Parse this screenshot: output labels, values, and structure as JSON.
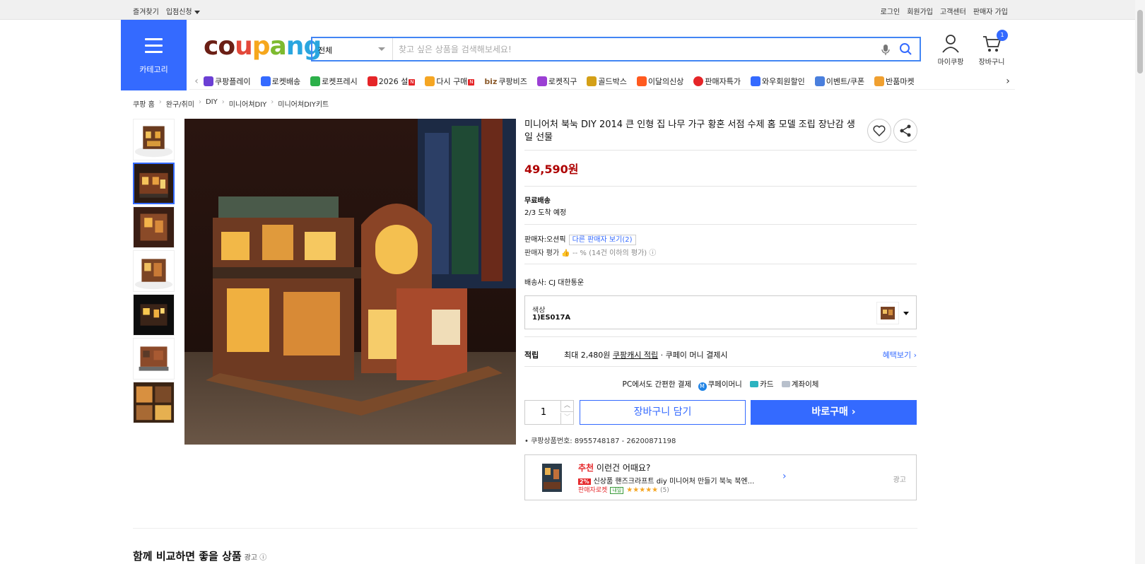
{
  "util": {
    "left": [
      "즐겨찾기",
      "입점신청"
    ],
    "right": [
      "로그인",
      "회원가입",
      "고객센터",
      "판매자 가입"
    ]
  },
  "header": {
    "category_label": "카테고리",
    "logo": [
      "c",
      "o",
      "u",
      "p",
      "a",
      "n",
      "g"
    ],
    "search_scope": "전체",
    "search_placeholder": "찾고 싶은 상품을 검색해보세요!",
    "mycoupang": "마이쿠팡",
    "cart": "장바구니",
    "cart_count": "1"
  },
  "nav": [
    {
      "label": "쿠팡플레이",
      "icon": "play-icon",
      "color": "#6b3fd4"
    },
    {
      "label": "로켓배송",
      "icon": "rocket-icon",
      "color": "#346aff"
    },
    {
      "label": "로켓프레시",
      "icon": "fresh-rocket-icon",
      "color": "#2cb04a"
    },
    {
      "label": "2026 설",
      "icon": "hanbok-icon",
      "color": "#e52528",
      "badge": "N"
    },
    {
      "label": "다시 구매",
      "icon": "home-icon",
      "color": "#f5a623",
      "badge": "N"
    },
    {
      "label": "쿠팡비즈",
      "icon": "biz-icon",
      "color": "#8b5a2b",
      "prefix": "biz"
    },
    {
      "label": "로켓직구",
      "icon": "global-icon",
      "color": "#9b3fd4"
    },
    {
      "label": "골드박스",
      "icon": "goldbox-icon",
      "color": "#d4a017"
    },
    {
      "label": "이달의신상",
      "icon": "new-icon",
      "color": "#ff5a1f"
    },
    {
      "label": "판매자특가",
      "icon": "sale-icon",
      "color": "#e52528"
    },
    {
      "label": "와우회원할인",
      "icon": "wow-icon",
      "color": "#346aff"
    },
    {
      "label": "이벤트/쿠폰",
      "icon": "coupon-icon",
      "color": "#4a7fdd"
    },
    {
      "label": "반품마켓",
      "icon": "market-icon",
      "color": "#f0a030"
    }
  ],
  "breadcrumb": [
    "쿠팡 홈",
    "완구/취미",
    "DIY",
    "미니어쳐DIY",
    "미니어쳐DIY키트"
  ],
  "product": {
    "title": "미니어처 북눅 DIY 2014 큰 인형 집 나무 가구 황혼 서점 수제 홈 모델 조립 장난감 생일 선물",
    "price": "49,590원",
    "shipping_title": "무료배송",
    "shipping_eta": "2/3 도착 예정",
    "seller_label": "판매자:오션픽",
    "other_sellers": "다른 판매자 보기(2)",
    "rating_label": "판매자 평가",
    "rating_value": "-- % (14건 이하의 평가)",
    "carrier": "배송사:  CJ 대한통운",
    "option_label": "색상",
    "option_value": "1)ES017A",
    "earn_label": "적립",
    "earn_pre": "최대 2,480원",
    "earn_link": "쿠팡캐시 적립",
    "earn_post": "· 쿠페이 머니 결제시",
    "earn_more": "혜택보기",
    "pay_intro": "PC에서도 간편한 결제",
    "pay_opts": [
      "쿠페이머니",
      "카드",
      "계좌이체"
    ],
    "qty": "1",
    "add_cart": "장바구니 담기",
    "buy_now": "바로구매",
    "product_id": "쿠팡상품번호: 8955748187 - 26200871198"
  },
  "recommend": {
    "head_red": "추천",
    "head_rest": " 이런건 어때요?",
    "pct": "2%",
    "name": "신상품 핸즈크라프트 diy 미니어처 만들기 북눅 북엔...",
    "seller_tag": "판매자로켓",
    "tomorrow": "내일",
    "stars": "★★★★★",
    "count": "(5)",
    "ad": "광고"
  },
  "compare": {
    "title": "함께 비교하면 좋을 상품",
    "ad": "광고"
  }
}
